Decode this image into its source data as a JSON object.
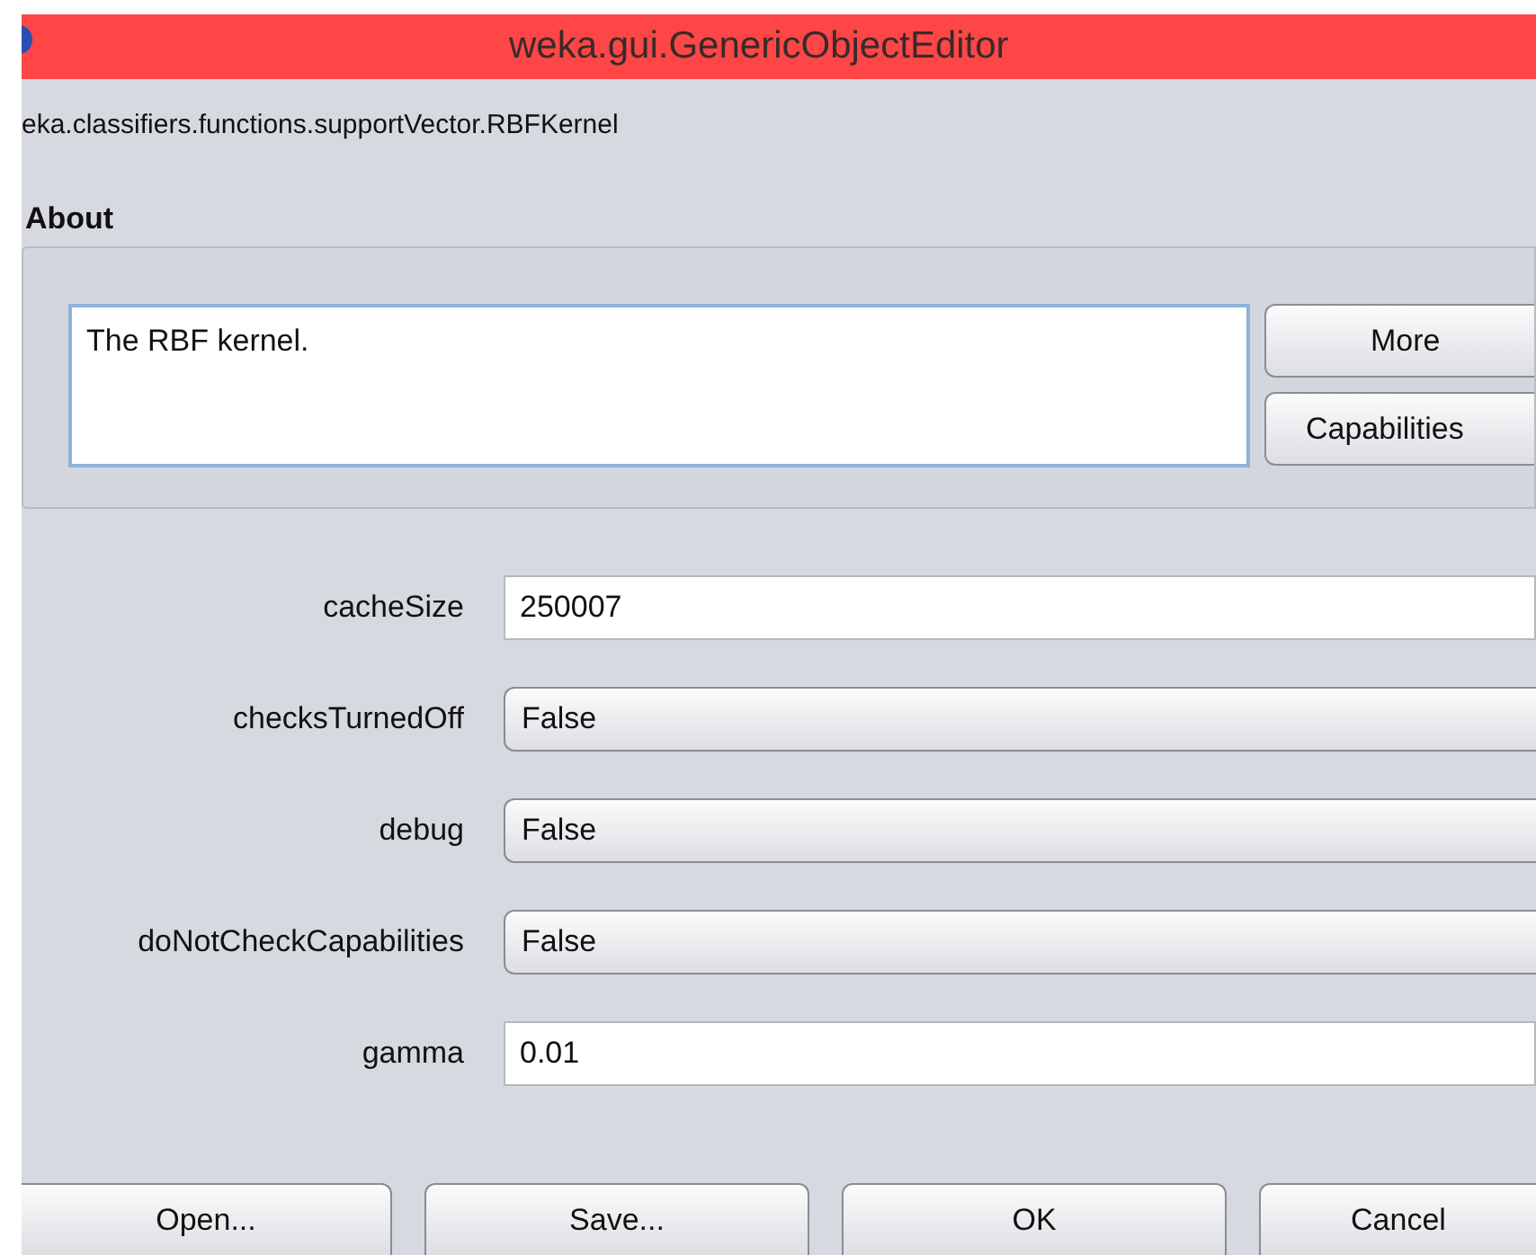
{
  "window": {
    "title": "weka.gui.GenericObjectEditor"
  },
  "class_name": "eka.classifiers.functions.supportVector.RBFKernel",
  "about": {
    "heading": "About",
    "text": "The RBF kernel.",
    "buttons": [
      "More",
      "Capabilities"
    ]
  },
  "properties": [
    {
      "label": "cacheSize",
      "kind": "text",
      "value": "250007"
    },
    {
      "label": "checksTurnedOff",
      "kind": "choice",
      "value": "False"
    },
    {
      "label": "debug",
      "kind": "choice",
      "value": "False"
    },
    {
      "label": "doNotCheckCapabilities",
      "kind": "choice",
      "value": "False"
    },
    {
      "label": "gamma",
      "kind": "text",
      "value": "0.01"
    }
  ],
  "buttons": [
    "Open...",
    "Save...",
    "OK",
    "Cancel"
  ]
}
